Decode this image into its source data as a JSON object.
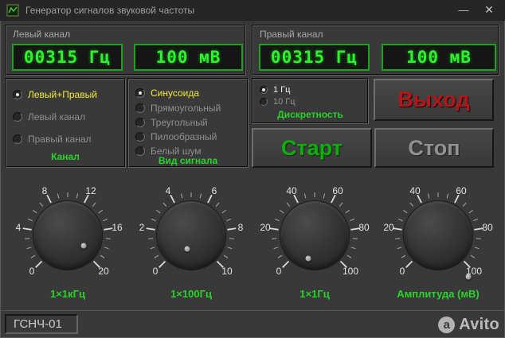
{
  "window": {
    "title": "Генератор сигналов звуковой частоты",
    "minimize": "—",
    "close": "✕"
  },
  "channels": {
    "left": {
      "caption": "Левый канал",
      "frequency": "00315 Гц",
      "amplitude": "100 мВ"
    },
    "right": {
      "caption": "Правый канал",
      "frequency": "00315 Гц",
      "amplitude": "100 мВ"
    }
  },
  "channel_group": {
    "caption": "Канал",
    "options": [
      {
        "label": "Левый+Правый",
        "selected": true
      },
      {
        "label": "Левый канал",
        "selected": false
      },
      {
        "label": "Правый канал",
        "selected": false
      }
    ]
  },
  "signal_group": {
    "caption": "Вид сигнала",
    "options": [
      {
        "label": "Синусоида",
        "selected": true
      },
      {
        "label": "Прямоугольный",
        "selected": false
      },
      {
        "label": "Треугольный",
        "selected": false
      },
      {
        "label": "Пилообразный",
        "selected": false
      },
      {
        "label": "Белый шум",
        "selected": false
      }
    ]
  },
  "discreteness_group": {
    "caption": "Дискретность",
    "options": [
      {
        "label": "1 Гц",
        "selected": true
      },
      {
        "label": "10 Гц",
        "selected": false
      }
    ]
  },
  "buttons": {
    "exit": "Выход",
    "start": "Старт",
    "stop": "Стоп"
  },
  "knobs": [
    {
      "name": "1×1кГц",
      "labels": [
        "0",
        "4",
        "8",
        "12",
        "16",
        "20"
      ]
    },
    {
      "name": "1×100Гц",
      "labels": [
        "0",
        "2",
        "4",
        "6",
        "8",
        "10"
      ]
    },
    {
      "name": "1×1Гц",
      "labels": [
        "0",
        "20",
        "40",
        "60",
        "80",
        "100"
      ]
    },
    {
      "name": "Амплитуда (мВ)",
      "labels": [
        "0",
        "20",
        "40",
        "60",
        "80",
        "100"
      ]
    }
  ],
  "statusbar": {
    "model": "ГСНЧ-01"
  },
  "watermark": {
    "icon_letter": "a",
    "text": "Avito"
  },
  "colors": {
    "accent_green": "#27d427",
    "selected_yellow": "#f0ea3a",
    "exit_red": "#b41717",
    "display_green": "#2df32d"
  }
}
